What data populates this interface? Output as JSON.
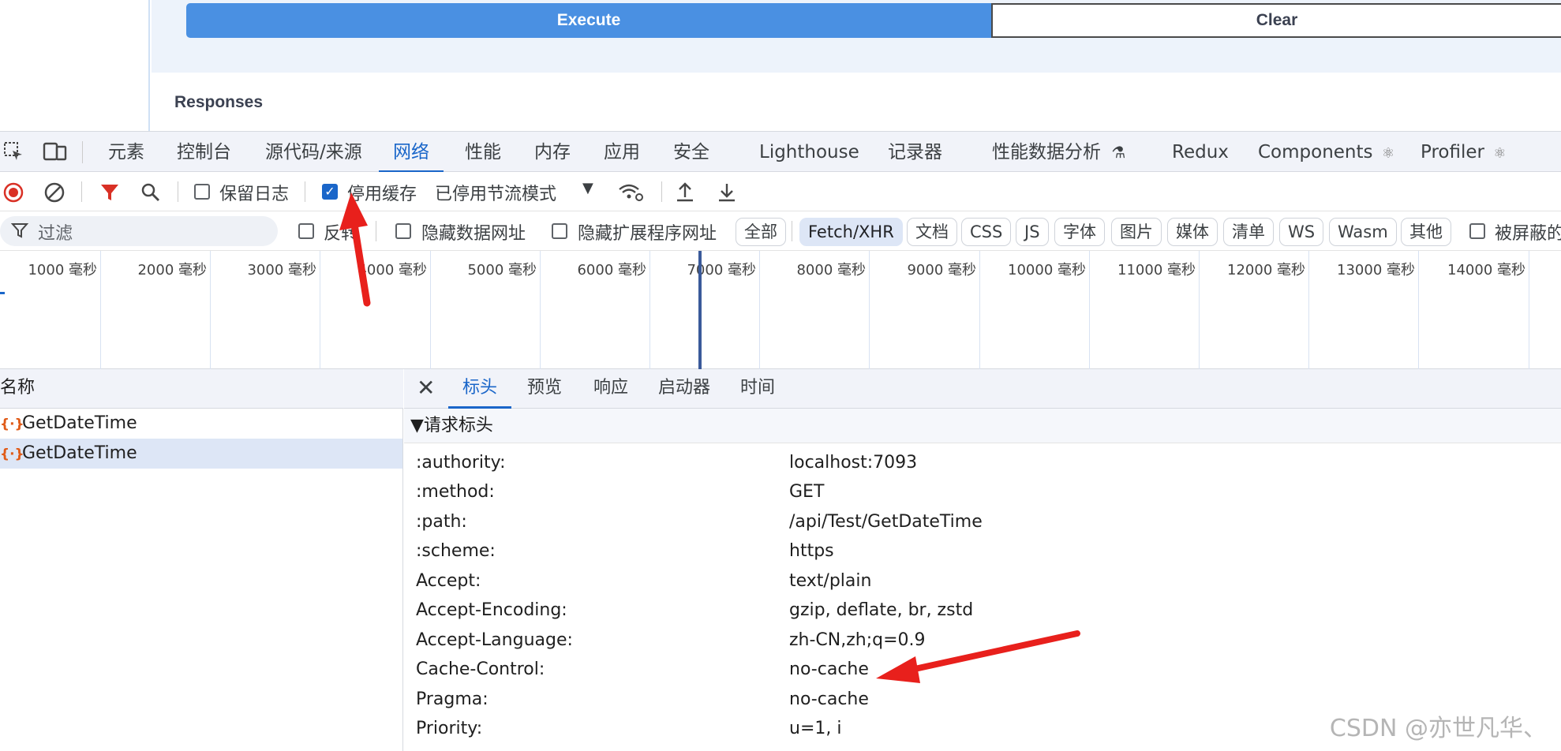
{
  "swagger": {
    "execute_label": "Execute",
    "clear_label": "Clear",
    "responses_heading": "Responses"
  },
  "devtools": {
    "main_tabs": [
      {
        "label": "元素"
      },
      {
        "label": "控制台"
      },
      {
        "label": "源代码/来源"
      },
      {
        "label": "网络"
      },
      {
        "label": "性能"
      },
      {
        "label": "内存"
      },
      {
        "label": "应用"
      },
      {
        "label": "安全"
      },
      {
        "label": "Lighthouse"
      },
      {
        "label": "记录器"
      },
      {
        "label": "性能数据分析"
      },
      {
        "label": "Redux"
      },
      {
        "label": "Components"
      },
      {
        "label": "Profiler"
      }
    ],
    "toolbar": {
      "preserve_log": "保留日志",
      "disable_cache": "停用缓存",
      "throttling": "已停用节流模式"
    },
    "filter": {
      "placeholder": "过滤",
      "invert": "反转",
      "hide_data_urls": "隐藏数据网址",
      "hide_ext_urls": "隐藏扩展程序网址",
      "types": [
        "全部",
        "Fetch/XHR",
        "文档",
        "CSS",
        "JS",
        "字体",
        "图片",
        "媒体",
        "清单",
        "WS",
        "Wasm",
        "其他"
      ],
      "blocked": "被屏蔽的"
    },
    "timeline_ticks": [
      "1000 毫秒",
      "2000 毫秒",
      "3000 毫秒",
      "4000 毫秒",
      "5000 毫秒",
      "6000 毫秒",
      "7000 毫秒",
      "8000 毫秒",
      "9000 毫秒",
      "10000 毫秒",
      "11000 毫秒",
      "12000 毫秒",
      "13000 毫秒",
      "14000 毫秒"
    ],
    "name_column": "名称",
    "requests": [
      {
        "name": "GetDateTime"
      },
      {
        "name": "GetDateTime"
      }
    ],
    "detail_tabs": [
      "标头",
      "预览",
      "响应",
      "启动器",
      "时间"
    ],
    "request_headers_title": "▼请求标头",
    "headers": [
      {
        "name": ":authority:",
        "value": "localhost:7093"
      },
      {
        "name": ":method:",
        "value": "GET"
      },
      {
        "name": ":path:",
        "value": "/api/Test/GetDateTime"
      },
      {
        "name": ":scheme:",
        "value": "https"
      },
      {
        "name": "Accept:",
        "value": "text/plain"
      },
      {
        "name": "Accept-Encoding:",
        "value": "gzip, deflate, br, zstd"
      },
      {
        "name": "Accept-Language:",
        "value": "zh-CN,zh;q=0.9"
      },
      {
        "name": "Cache-Control:",
        "value": "no-cache"
      },
      {
        "name": "Pragma:",
        "value": "no-cache"
      },
      {
        "name": "Priority:",
        "value": "u=1, i"
      }
    ]
  },
  "watermark": "CSDN @亦世凡华、",
  "colors": {
    "accent": "#1a66c9",
    "execute": "#4a90e2",
    "annotation": "#e8201c"
  }
}
